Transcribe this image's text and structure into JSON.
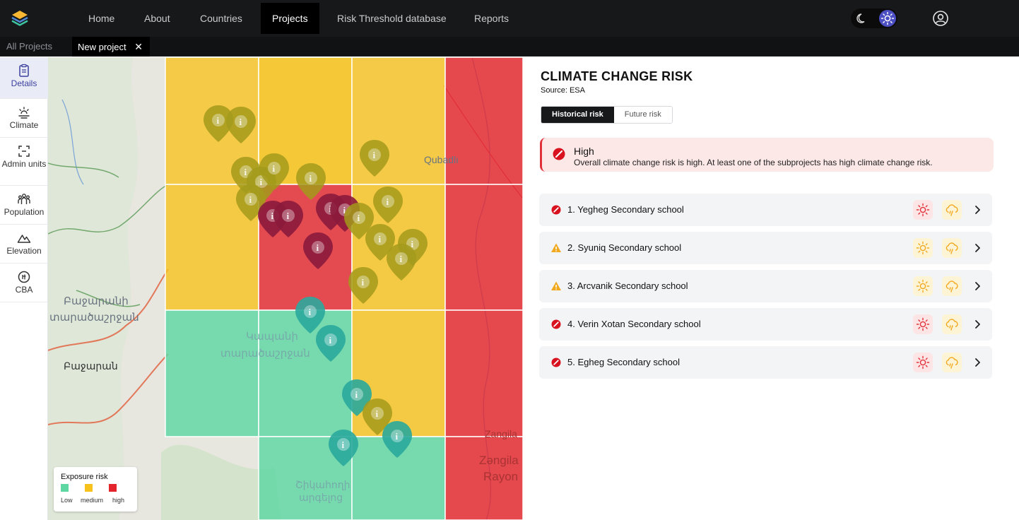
{
  "nav": {
    "items": [
      {
        "label": "Home",
        "active": false
      },
      {
        "label": "About",
        "active": false
      },
      {
        "label": "Countries",
        "active": false
      },
      {
        "label": "Projects",
        "active": true
      },
      {
        "label": "Risk Threshold database",
        "active": false
      },
      {
        "label": "Reports",
        "active": false
      }
    ],
    "theme_icons": [
      "moon-icon",
      "sun-icon"
    ],
    "user_icon": "user-circle-icon"
  },
  "subtabs": {
    "all": "All Projects",
    "current": "New project",
    "close_icon": "close-icon"
  },
  "sidebar": {
    "items": [
      {
        "label": "Details",
        "icon": "clipboard-icon",
        "active": true
      },
      {
        "label": "Climate",
        "icon": "sun-cloud-icon",
        "active": false
      },
      {
        "label": "Admin units",
        "icon": "frame-icon",
        "active": false
      },
      {
        "label": "Population",
        "icon": "people-icon",
        "active": false
      },
      {
        "label": "Elevation",
        "icon": "mountain-icon",
        "active": false
      },
      {
        "label": "CBA",
        "icon": "coin-icon",
        "active": false
      }
    ]
  },
  "map": {
    "place_labels": [
      "Qubadlı",
      "Բաջարանի",
      "տարածաշրջան",
      "Բաջարան",
      "Կապանի",
      "տարածաշրջան",
      "Zangila",
      "Zәngila",
      "Rayon",
      "Շիկահողի",
      "արգելոց"
    ],
    "legend": {
      "title": "Exposure risk",
      "items": [
        {
          "label": "Low",
          "color": "#5ed7a3"
        },
        {
          "label": "medium",
          "color": "#f7c21b"
        },
        {
          "label": "high",
          "color": "#e4242d"
        }
      ]
    },
    "risk_colors": {
      "low": "#5ed7a3",
      "medium": "#f7c21b",
      "high": "#e4242d"
    }
  },
  "panel": {
    "title": "CLIMATE CHANGE RISK",
    "source": "Source: ESA",
    "tabs": [
      {
        "label": "Historical risk",
        "active": true
      },
      {
        "label": "Future risk",
        "active": false
      }
    ],
    "alert": {
      "title": "High",
      "text": "Overall climate change risk is high. At least one of the subprojects has high climate change risk.",
      "icon": "no-entry-icon"
    },
    "subprojects": [
      {
        "label": "1. Yegheg Secondary school",
        "status": "high",
        "heat": "high",
        "rain": "medium"
      },
      {
        "label": "2. Syuniq Secondary school",
        "status": "medium",
        "heat": "medium",
        "rain": "medium"
      },
      {
        "label": "3. Arcvanik Secondary school",
        "status": "medium",
        "heat": "medium",
        "rain": "medium"
      },
      {
        "label": "4. Verin Xotan Secondary school",
        "status": "high",
        "heat": "high",
        "rain": "medium"
      },
      {
        "label": "5. Egheg Secondary school",
        "status": "high",
        "heat": "high",
        "rain": "medium"
      }
    ]
  }
}
